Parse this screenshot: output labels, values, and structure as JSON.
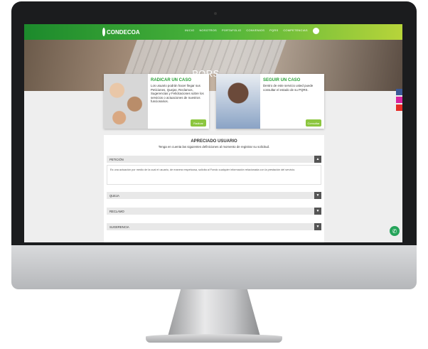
{
  "header": {
    "logo_text": "CONDECOA",
    "menu": [
      "INICIO",
      "NOSOTROS",
      "PORTAFOLIO",
      "CONVENIOS",
      "PQRS",
      "COMPETENCIAS"
    ]
  },
  "hero": {
    "title": "PQRS"
  },
  "card_radicar": {
    "title": "RADICAR UN CASO",
    "text": "Los usuario podrán hacer llegar sus Peticiones, Quejas, Reclamos, Sugerencias y Felicitaciones sobre los servicios o actuaciones de nuestros funcionarios.",
    "button": "Radicar"
  },
  "card_seguir": {
    "title": "SEGUIR UN CASO",
    "text": "Dentro de este servicio usted puede consultar el estado de su PQRS.",
    "button": "Consultar"
  },
  "form": {
    "title": "APRECIADO USUARIO",
    "subtitle": "Tenga en cuenta las siguientes definiciones al momento de registrar su solicitud.",
    "items": [
      "PETICIÓN",
      "QUEJA",
      "RECLAMO",
      "SUGERENCIA"
    ],
    "peticion_text": "Es una actuación por medio de la cual el usuario, de manera respetuosa, solicita al Fondo cualquier información relacionada con la prestación del servicio.",
    "toggle_open": "▲",
    "toggle_closed": "▼"
  },
  "colors": {
    "nav_green": "#1c8a2c",
    "accent": "#8cc63f",
    "title_green": "#2aa038"
  },
  "icons": [
    "facebook-icon",
    "instagram-icon",
    "youtube-icon",
    "whatsapp-icon",
    "user-icon"
  ]
}
